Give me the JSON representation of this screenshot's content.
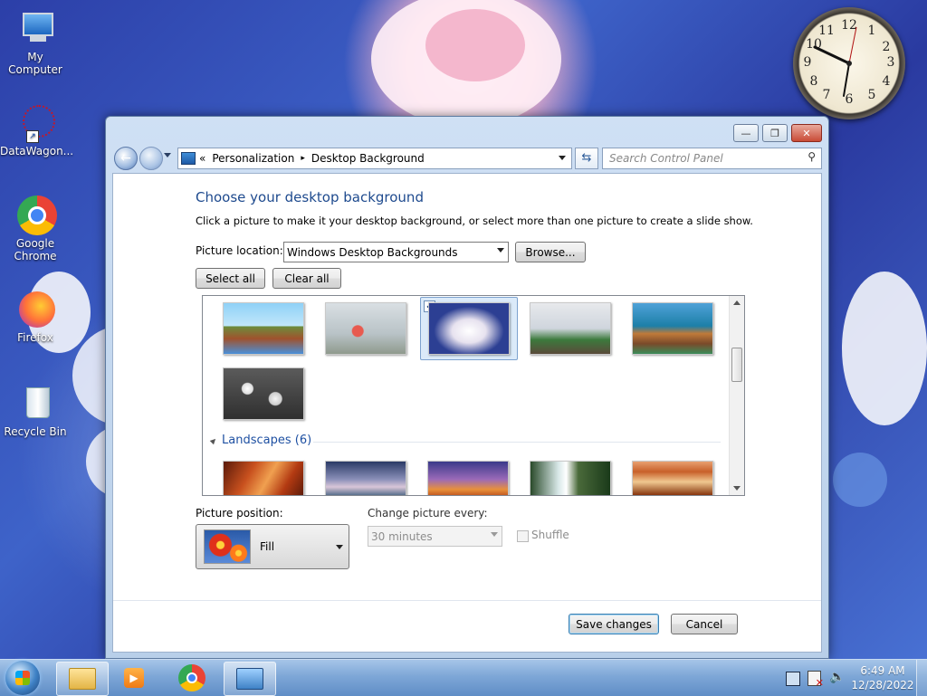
{
  "desktop": {
    "icons": [
      {
        "label": "My Computer"
      },
      {
        "label": "DataWagon..."
      },
      {
        "label": "Google Chrome"
      },
      {
        "label": "Firefox"
      },
      {
        "label": "Recycle Bin"
      }
    ],
    "clock_numbers": [
      "12",
      "1",
      "2",
      "3",
      "4",
      "5",
      "6",
      "7",
      "8",
      "9",
      "10",
      "11"
    ]
  },
  "window": {
    "controls": {
      "minimize": "—",
      "maximize": "❐",
      "close": "✕"
    },
    "breadcrumb": {
      "chevron": "«",
      "items": [
        "Personalization",
        "Desktop Background"
      ],
      "separator": "▸"
    },
    "search": {
      "placeholder": "Search Control Panel"
    },
    "heading": "Choose your desktop background",
    "instructions": "Click a picture to make it your desktop background, or select more than one picture to create a slide show.",
    "picture_location": {
      "label": "Picture location:",
      "value": "Windows Desktop Backgrounds"
    },
    "buttons": {
      "browse": "Browse...",
      "select_all": "Select all",
      "clear_all": "Clear all",
      "save": "Save changes",
      "cancel": "Cancel"
    },
    "gallery": {
      "group_title": "Landscapes (6)",
      "selected_index": 2
    },
    "picture_position": {
      "label": "Picture position:",
      "value": "Fill"
    },
    "change_picture": {
      "label": "Change picture every:",
      "value": "30 minutes",
      "enabled": false
    },
    "shuffle": {
      "label": "Shuffle",
      "checked": false,
      "enabled": false
    }
  },
  "taskbar": {
    "time": "6:49 AM",
    "date": "12/28/2022",
    "items": [
      "start-orb",
      "windows-explorer",
      "media-player",
      "google-chrome",
      "control-panel"
    ]
  },
  "colors": {
    "heading": "#1e4a8e",
    "link_blue": "#1e50a2",
    "selection": "#dbeaf9"
  }
}
